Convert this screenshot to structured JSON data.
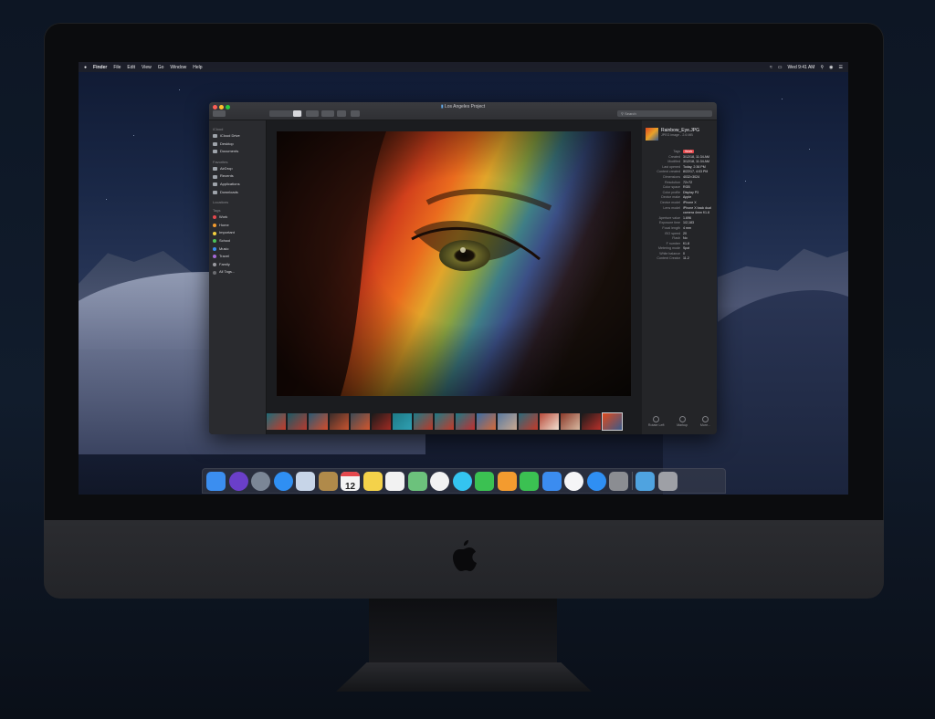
{
  "menubar": {
    "apple": "",
    "items": [
      "Finder",
      "File",
      "Edit",
      "View",
      "Go",
      "Window",
      "Help"
    ],
    "clock": "Wed 9:41 AM"
  },
  "window": {
    "title": "Los Angeles Project",
    "search_placeholder": "Search"
  },
  "sidebar": {
    "sections": [
      {
        "header": "iCloud",
        "items": [
          "iCloud Drive",
          "Desktop",
          "Documents"
        ]
      },
      {
        "header": "Favorites",
        "items": [
          "AirDrop",
          "Recents",
          "Applications",
          "Downloads"
        ]
      },
      {
        "header": "Locations",
        "items": []
      }
    ],
    "tags_header": "Tags",
    "tags": [
      {
        "label": "Work",
        "color": "#e5484d"
      },
      {
        "label": "Home",
        "color": "#f39b2f"
      },
      {
        "label": "Important",
        "color": "#f4d03f"
      },
      {
        "label": "School",
        "color": "#4cc259"
      },
      {
        "label": "Music",
        "color": "#3b8cf0"
      },
      {
        "label": "Travel",
        "color": "#a56ad6"
      },
      {
        "label": "Family",
        "color": "#9a9aa0"
      },
      {
        "label": "All Tags...",
        "color": "#6b6c70"
      }
    ]
  },
  "info": {
    "filename": "Rainbow_Eye.JPG",
    "filesub": "JPEG image - 2.6 MB",
    "tag_key": "Tags",
    "tag_value": "Work",
    "rows": [
      {
        "k": "Created",
        "v": "3/12/18, 11:34 AM"
      },
      {
        "k": "Modified",
        "v": "3/12/18, 11:34 AM"
      },
      {
        "k": "Last opened",
        "v": "Today, 2:36 PM"
      },
      {
        "k": "Content created",
        "v": "8/22/17, 4:03 PM"
      },
      {
        "k": "Dimensions",
        "v": "4032×3024"
      },
      {
        "k": "Resolution",
        "v": "72×72"
      },
      {
        "k": "Color space",
        "v": "RGB"
      },
      {
        "k": "Color profile",
        "v": "Display P3"
      },
      {
        "k": "Device make",
        "v": "Apple"
      },
      {
        "k": "Device model",
        "v": "iPhone X"
      },
      {
        "k": "Lens model",
        "v": "iPhone X back dual"
      },
      {
        "k": "",
        "v": "camera 4mm f/1.8"
      },
      {
        "k": "Aperture value",
        "v": "1.696"
      },
      {
        "k": "Exposure time",
        "v": "1/2,183"
      },
      {
        "k": "Focal length",
        "v": "4 mm"
      },
      {
        "k": "ISO speed",
        "v": "20"
      },
      {
        "k": "Flash",
        "v": "No"
      },
      {
        "k": "F number",
        "v": "f/1.8"
      },
      {
        "k": "Metering mode",
        "v": "Spot"
      },
      {
        "k": "White balance",
        "v": "0"
      },
      {
        "k": "Content Creator",
        "v": "11.2"
      }
    ],
    "actions": [
      "Rotate Left",
      "Markup",
      "More..."
    ]
  },
  "dock": {
    "apps": [
      {
        "name": "finder-icon",
        "color": "#3b8ef0"
      },
      {
        "name": "siri-icon",
        "color": "#6a3fc9"
      },
      {
        "name": "launchpad-icon",
        "color": "#7b8696"
      },
      {
        "name": "safari-icon",
        "color": "#2f8ff3"
      },
      {
        "name": "preview-icon",
        "color": "#c7d5e8"
      },
      {
        "name": "notes-icon",
        "color": "#b08a4a"
      },
      {
        "name": "calendar-icon",
        "color": "#f4f4f4"
      },
      {
        "name": "stickies-icon",
        "color": "#f4d24a"
      },
      {
        "name": "reminders-icon",
        "color": "#f2f2f2"
      },
      {
        "name": "maps-icon",
        "color": "#6cc27c"
      },
      {
        "name": "photos-icon",
        "color": "#f2f2f2"
      },
      {
        "name": "messages-icon",
        "color": "#34c4f0"
      },
      {
        "name": "facetime-icon",
        "color": "#3bc152"
      },
      {
        "name": "pages-icon",
        "color": "#f39b2f"
      },
      {
        "name": "numbers-icon",
        "color": "#3bc152"
      },
      {
        "name": "keynote-icon",
        "color": "#3b8cf0"
      },
      {
        "name": "itunes-icon",
        "color": "#f5f5f7"
      },
      {
        "name": "app-store-icon",
        "color": "#2f8ff3"
      },
      {
        "name": "system-preferences-icon",
        "color": "#8b8d92"
      }
    ],
    "calendar_day": "12",
    "right": [
      {
        "name": "downloads-folder-icon",
        "color": "#4fa3e0"
      },
      {
        "name": "trash-icon",
        "color": "#9ea0a6"
      }
    ]
  }
}
